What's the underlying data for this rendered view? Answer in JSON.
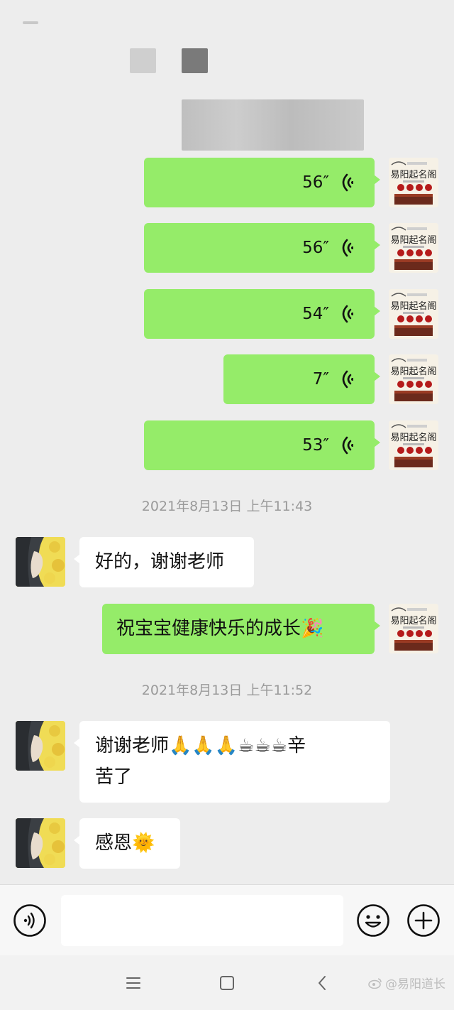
{
  "colors": {
    "background": "#ededed",
    "sent_bubble": "#95ec69",
    "received_bubble": "#ffffff",
    "timestamp": "#9a9a9a"
  },
  "sent_avatar_text": "易阳起名阁",
  "voice_messages": [
    {
      "duration": "56″"
    },
    {
      "duration": "56″"
    },
    {
      "duration": "54″"
    },
    {
      "duration": "7″"
    },
    {
      "duration": "53″"
    }
  ],
  "timestamps": [
    "2021年8月13日 上午11:43",
    "2021年8月13日 上午11:52"
  ],
  "messages": {
    "m1": {
      "text": "好的，谢谢老师"
    },
    "m2": {
      "text": "祝宝宝健康快乐的成长",
      "emoji": "🎉"
    },
    "m3": {
      "text1": "谢谢老师",
      "emoji1": "🙏🙏🙏☕☕☕",
      "text2": "辛",
      "text3": "苦了"
    },
    "m4": {
      "text": "感恩",
      "emoji": "🌞"
    }
  },
  "input": {
    "placeholder": "",
    "voice_icon": "voice-mode-icon",
    "emoji_icon": "emoji-icon",
    "plus_icon": "plus-icon"
  },
  "nav": {
    "menu_icon": "menu-icon",
    "home_icon": "home-icon",
    "back_icon": "back-icon"
  },
  "watermark": "@易阳道长"
}
